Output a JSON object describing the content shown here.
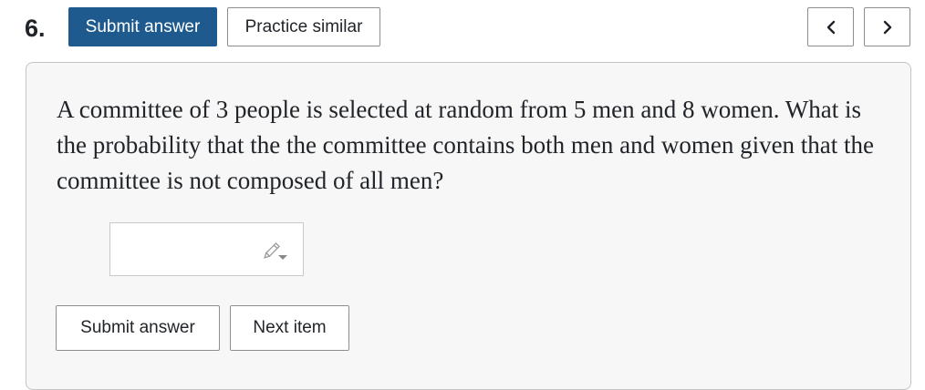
{
  "header": {
    "question_number": "6.",
    "submit_label": "Submit answer",
    "practice_label": "Practice similar",
    "prev_icon": "chevron-left-icon",
    "next_icon": "chevron-right-icon"
  },
  "question": {
    "text": "A committee of 3 people is selected at random from 5 men and 8 women. What is the probability that the the committee contains both men and women given that the committee is not composed of all men?"
  },
  "answer": {
    "value": "",
    "icon": "pencil-icon"
  },
  "footer": {
    "submit_label": "Submit answer",
    "next_label": "Next item"
  },
  "colors": {
    "primary": "#1f5a8e",
    "card_background": "#f7f7f7",
    "border": "#8a8f94"
  }
}
